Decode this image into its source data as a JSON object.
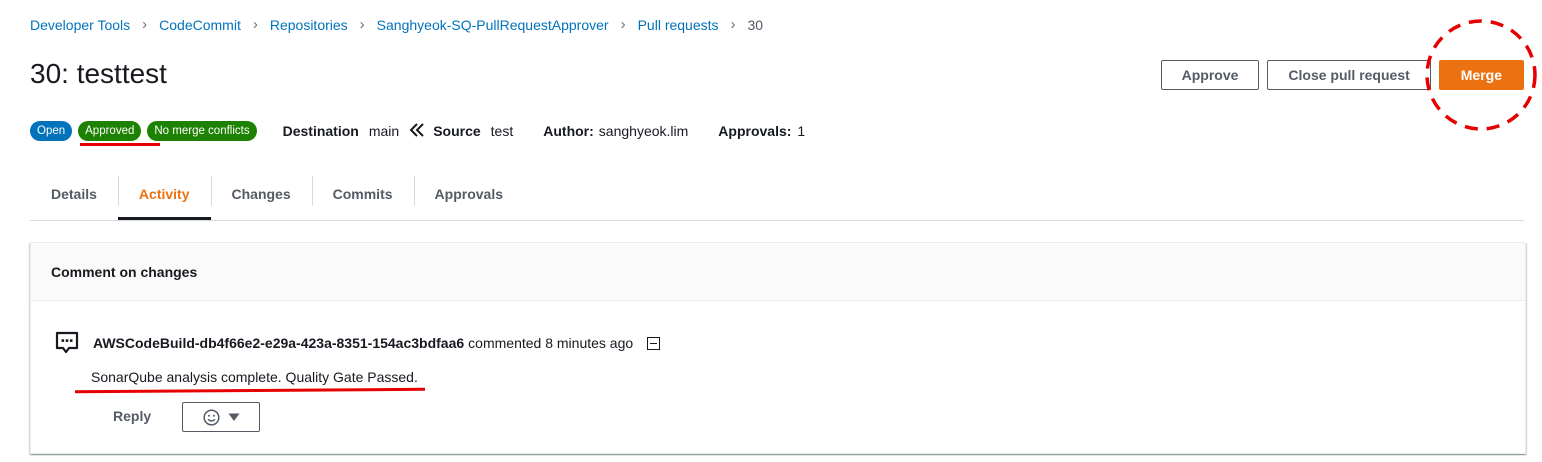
{
  "breadcrumb": {
    "items": [
      "Developer Tools",
      "CodeCommit",
      "Repositories",
      "Sanghyeok-SQ-PullRequestApprover",
      "Pull requests"
    ],
    "current": "30"
  },
  "page": {
    "title": "30: testtest"
  },
  "actions": {
    "approve": "Approve",
    "close": "Close pull request",
    "merge": "Merge"
  },
  "badges": {
    "open": "Open",
    "approved": "Approved",
    "no_conflicts": "No merge conflicts"
  },
  "meta": {
    "destination_label": "Destination",
    "destination_value": "main",
    "source_label": "Source",
    "source_value": "test",
    "author_label": "Author:",
    "author_value": "sanghyeok.lim",
    "approvals_label": "Approvals:",
    "approvals_value": "1"
  },
  "tabs": [
    "Details",
    "Activity",
    "Changes",
    "Commits",
    "Approvals"
  ],
  "active_tab": "Activity",
  "panel": {
    "header": "Comment on changes",
    "comment": {
      "author": "AWSCodeBuild-db4f66e2-e29a-423a-8351-154ac3bdfaa6",
      "meta": "commented 8 minutes ago",
      "body": "SonarQube analysis complete. Quality Gate Passed.",
      "reply_label": "Reply"
    }
  },
  "colors": {
    "link": "#0073bb",
    "primary": "#ec7211",
    "success": "#1d8102",
    "annotation": "#e60000"
  }
}
